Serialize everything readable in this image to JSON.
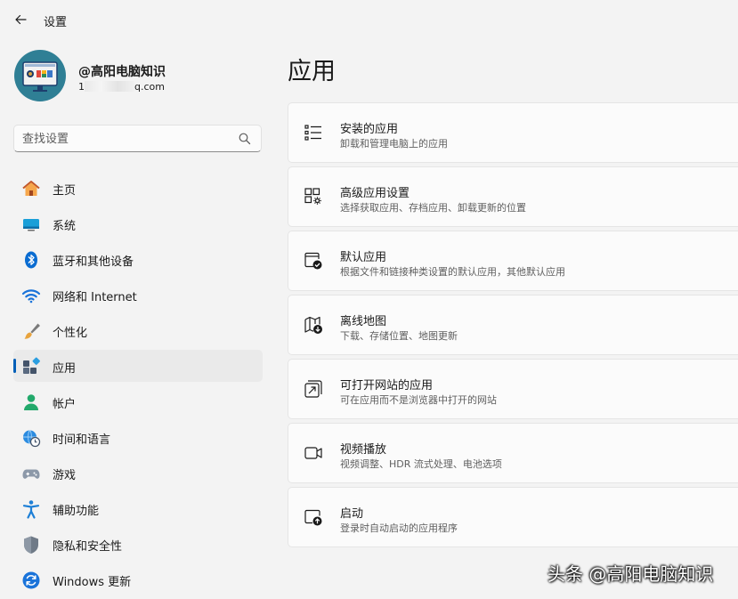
{
  "window": {
    "title": "设置"
  },
  "profile": {
    "name": "@高阳电脑知识",
    "email_prefix": "1",
    "email_suffix": "q.com"
  },
  "search": {
    "placeholder": "查找设置"
  },
  "nav": {
    "items": [
      {
        "label": "主页",
        "icon": "home-icon"
      },
      {
        "label": "系统",
        "icon": "monitor-icon"
      },
      {
        "label": "蓝牙和其他设备",
        "icon": "bluetooth-icon"
      },
      {
        "label": "网络和 Internet",
        "icon": "wifi-icon"
      },
      {
        "label": "个性化",
        "icon": "brush-icon"
      },
      {
        "label": "应用",
        "icon": "apps-icon",
        "active": true
      },
      {
        "label": "帐户",
        "icon": "person-icon"
      },
      {
        "label": "时间和语言",
        "icon": "globe-clock-icon"
      },
      {
        "label": "游戏",
        "icon": "gamepad-icon"
      },
      {
        "label": "辅助功能",
        "icon": "accessibility-icon"
      },
      {
        "label": "隐私和安全性",
        "icon": "shield-icon"
      },
      {
        "label": "Windows 更新",
        "icon": "update-icon"
      }
    ]
  },
  "main": {
    "title": "应用",
    "cards": [
      {
        "title": "安装的应用",
        "subtitle": "卸载和管理电脑上的应用",
        "icon": "list-icon"
      },
      {
        "title": "高级应用设置",
        "subtitle": "选择获取应用、存档应用、卸载更新的位置",
        "icon": "app-settings-icon"
      },
      {
        "title": "默认应用",
        "subtitle": "根据文件和链接种类设置的默认应用，其他默认应用",
        "icon": "default-app-icon"
      },
      {
        "title": "离线地图",
        "subtitle": "下载、存储位置、地图更新",
        "icon": "map-download-icon"
      },
      {
        "title": "可打开网站的应用",
        "subtitle": "可在应用而不是浏览器中打开的网站",
        "icon": "open-external-icon"
      },
      {
        "title": "视频播放",
        "subtitle": "视频调整、HDR 流式处理、电池选项",
        "icon": "video-icon"
      },
      {
        "title": "启动",
        "subtitle": "登录时自动启动的应用程序",
        "icon": "startup-icon"
      }
    ]
  },
  "watermark": {
    "text": "头条 @高阳电脑知识"
  },
  "colors": {
    "accent": "#005fb8",
    "background": "#f3f3f3",
    "card": "#fbfbfb",
    "selected": "#eaeaea"
  }
}
